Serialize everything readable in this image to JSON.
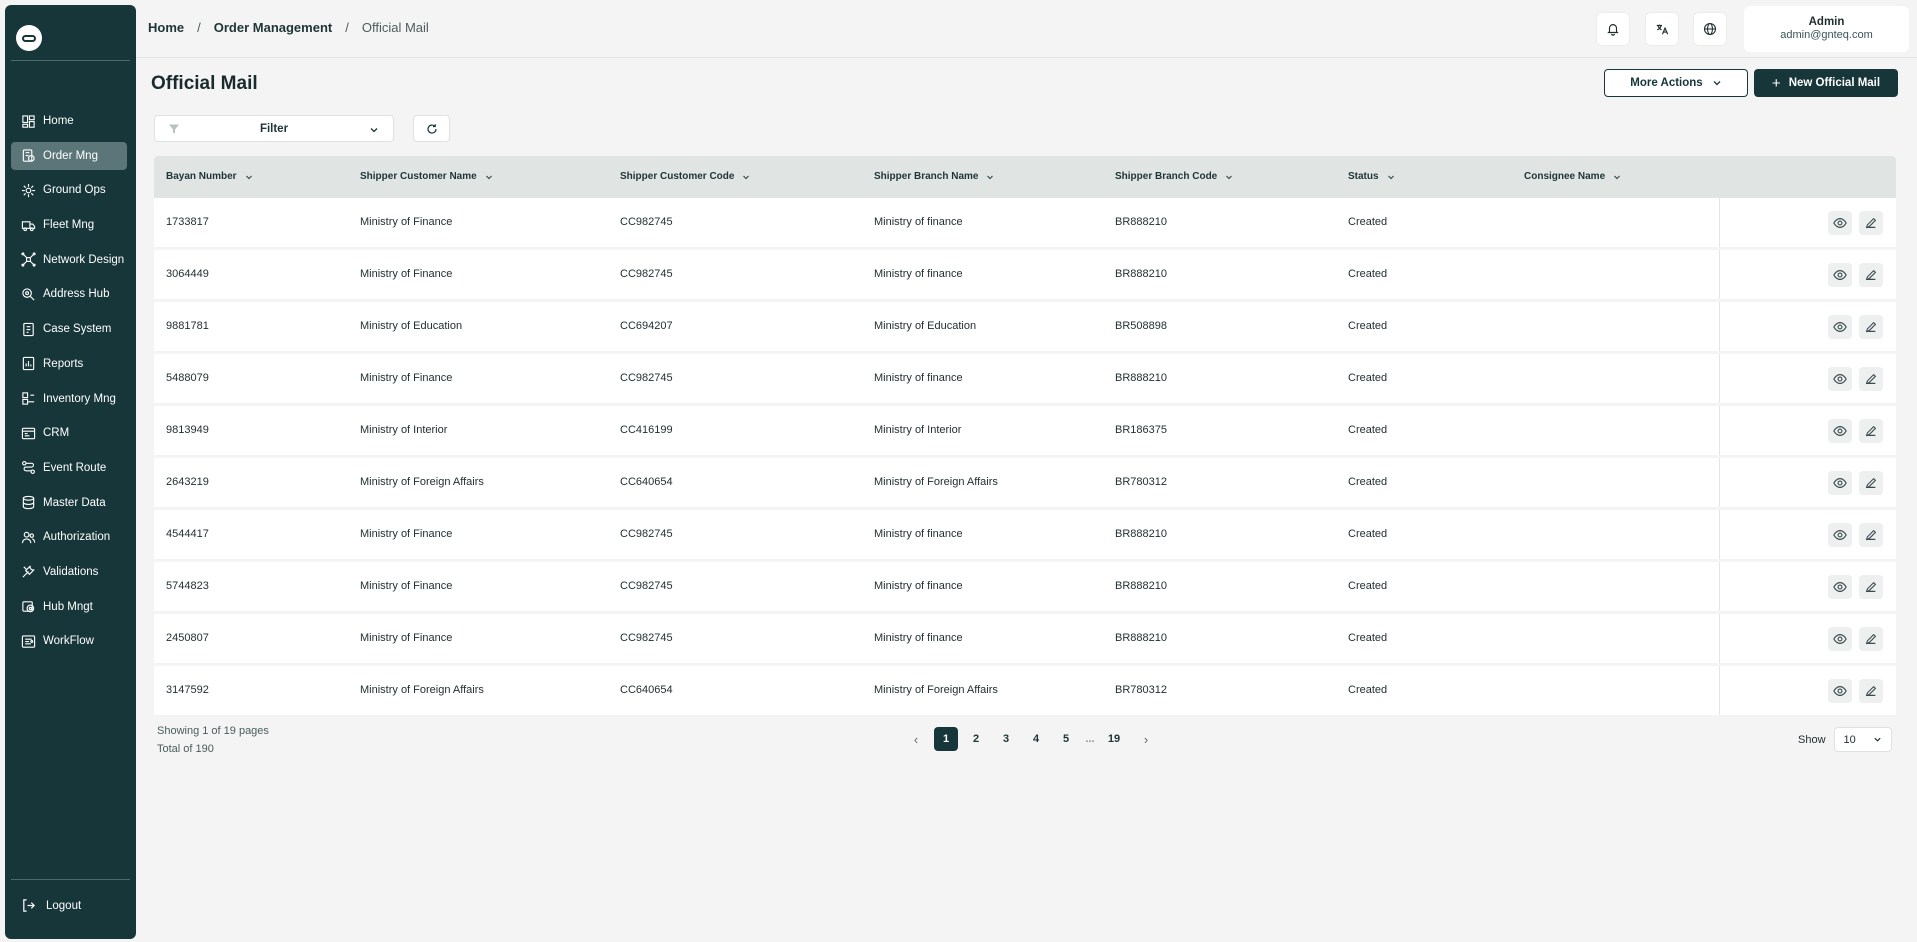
{
  "sidebar": {
    "items": [
      {
        "label": "Home",
        "icon": "dashboard-icon",
        "active": false
      },
      {
        "label": "Order Mng",
        "icon": "order-icon",
        "active": true
      },
      {
        "label": "Ground Ops",
        "icon": "ground-ops-icon",
        "active": false
      },
      {
        "label": "Fleet Mng",
        "icon": "truck-icon",
        "active": false
      },
      {
        "label": "Network Design",
        "icon": "network-icon",
        "active": false
      },
      {
        "label": "Address Hub",
        "icon": "address-icon",
        "active": false
      },
      {
        "label": "Case System",
        "icon": "case-icon",
        "active": false
      },
      {
        "label": "Reports",
        "icon": "report-icon",
        "active": false
      },
      {
        "label": "Inventory Mng",
        "icon": "inventory-icon",
        "active": false
      },
      {
        "label": "CRM",
        "icon": "crm-icon",
        "active": false
      },
      {
        "label": "Event Route",
        "icon": "route-icon",
        "active": false
      },
      {
        "label": "Master Data",
        "icon": "database-icon",
        "active": false
      },
      {
        "label": "Authorization",
        "icon": "users-icon",
        "active": false
      },
      {
        "label": "Validations",
        "icon": "tools-icon",
        "active": false
      },
      {
        "label": "Hub Mngt",
        "icon": "hub-icon",
        "active": false
      },
      {
        "label": "WorkFlow",
        "icon": "workflow-icon",
        "active": false
      }
    ],
    "logout_label": "Logout"
  },
  "header": {
    "breadcrumb": [
      "Home",
      "Order Management",
      "Official Mail"
    ],
    "user_name": "Admin",
    "user_email": "admin@gnteq.com"
  },
  "page": {
    "title": "Official Mail",
    "more_actions_label": "More Actions",
    "new_button_label": "New Official Mail",
    "filter_label": "Filter"
  },
  "table": {
    "columns": [
      "Bayan Number",
      "Shipper Customer Name",
      "Shipper Customer Code",
      "Shipper Branch Name",
      "Shipper Branch Code",
      "Status",
      "Consignee Name"
    ],
    "rows": [
      [
        "1733817",
        "Ministry of Finance",
        "CC982745",
        "Ministry of finance",
        "BR888210",
        "Created",
        ""
      ],
      [
        "3064449",
        "Ministry of Finance",
        "CC982745",
        "Ministry of finance",
        "BR888210",
        "Created",
        ""
      ],
      [
        "9881781",
        "Ministry of Education",
        "CC694207",
        "Ministry of Education",
        "BR508898",
        "Created",
        ""
      ],
      [
        "5488079",
        "Ministry of Finance",
        "CC982745",
        "Ministry of finance",
        "BR888210",
        "Created",
        ""
      ],
      [
        "9813949",
        "Ministry of Interior",
        "CC416199",
        "Ministry of Interior",
        "BR186375",
        "Created",
        ""
      ],
      [
        "2643219",
        "Ministry of Foreign Affairs",
        "CC640654",
        "Ministry of Foreign Affairs",
        "BR780312",
        "Created",
        ""
      ],
      [
        "4544417",
        "Ministry of Finance",
        "CC982745",
        "Ministry of finance",
        "BR888210",
        "Created",
        ""
      ],
      [
        "5744823",
        "Ministry of Finance",
        "CC982745",
        "Ministry of finance",
        "BR888210",
        "Created",
        ""
      ],
      [
        "2450807",
        "Ministry of Finance",
        "CC982745",
        "Ministry of finance",
        "BR888210",
        "Created",
        ""
      ],
      [
        "3147592",
        "Ministry of Foreign Affairs",
        "CC640654",
        "Ministry of Foreign Affairs",
        "BR780312",
        "Created",
        ""
      ]
    ]
  },
  "footer": {
    "showing": "Showing 1 of 19 pages",
    "total": "Total of 190",
    "pages": [
      "1",
      "2",
      "3",
      "4",
      "5",
      "...",
      "19"
    ],
    "current_page": "1",
    "prev_symbol": "‹",
    "next_symbol": "›",
    "show_label": "Show",
    "page_size": "10"
  },
  "colors": {
    "sidebar_bg": "#17363a",
    "primary": "#17363a",
    "active_item": "#5b7578",
    "table_header": "#e0e4e3",
    "page_bg": "#f3f4f3"
  }
}
